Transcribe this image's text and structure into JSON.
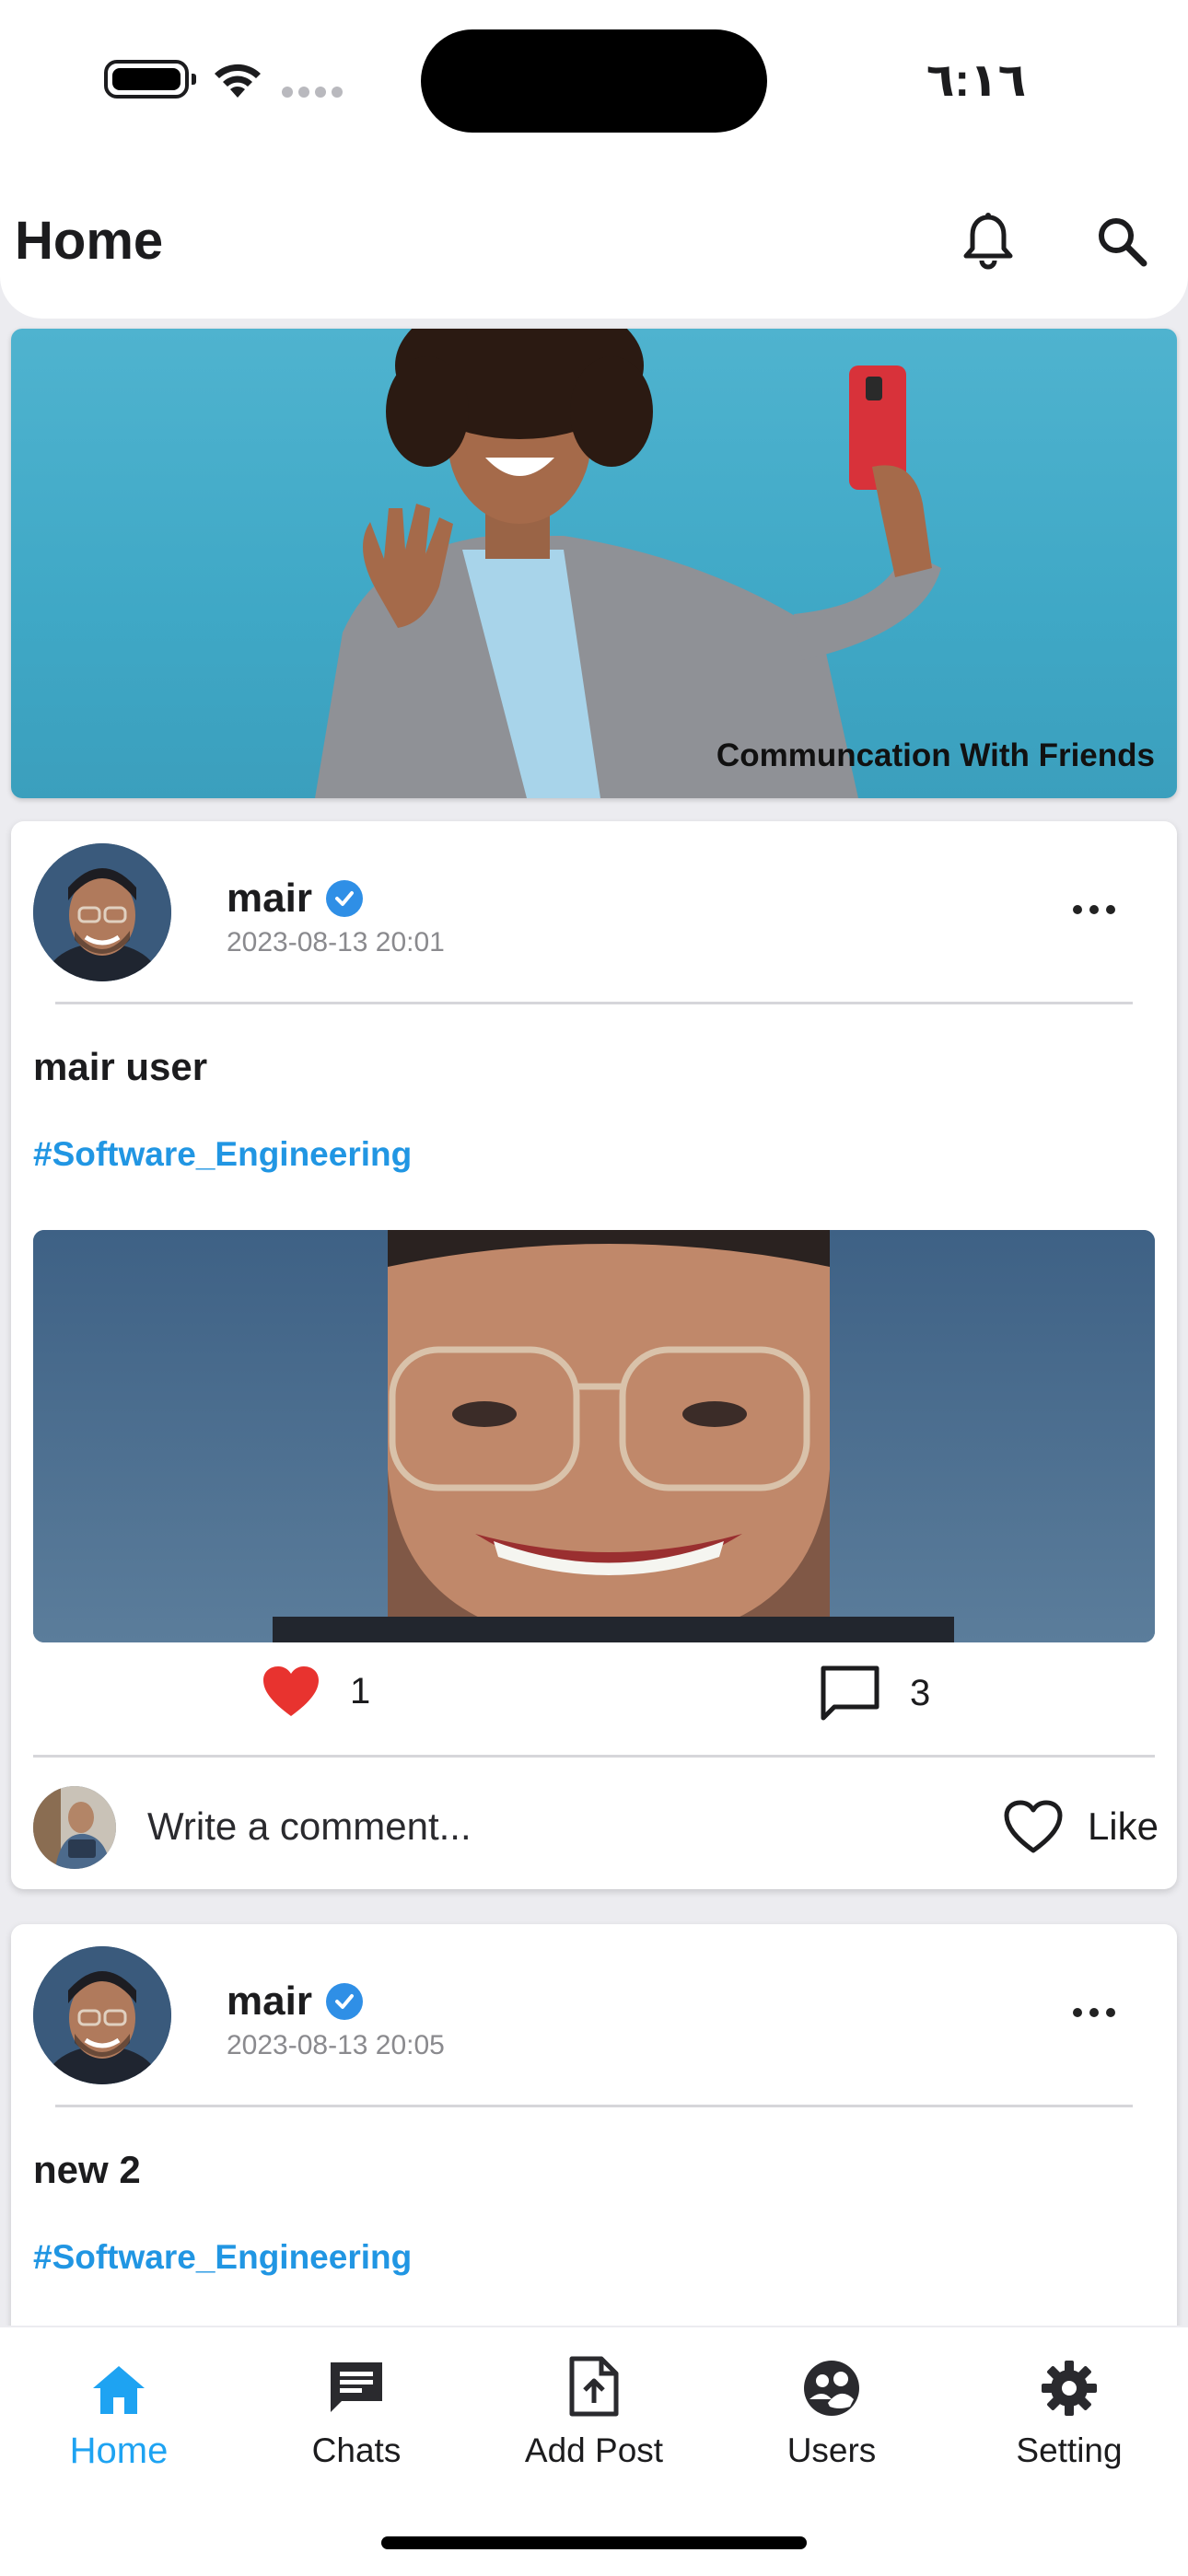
{
  "status_bar": {
    "time": "٦:١٦"
  },
  "app_bar": {
    "title": "Home",
    "notifications_icon": "bell-icon",
    "search_icon": "search-icon"
  },
  "banner": {
    "caption": "Communcation With Friends"
  },
  "posts": [
    {
      "author": "mair",
      "verified": true,
      "time": "2023-08-13 20:01",
      "text": "mair user",
      "hashtag": "#Software_Engineering",
      "likes": "1",
      "comments": "3",
      "comment_placeholder": "Write a comment...",
      "like_label": "Like"
    },
    {
      "author": "mair",
      "verified": true,
      "time": "2023-08-13 20:05",
      "text": "new 2",
      "hashtag": "#Software_Engineering"
    }
  ],
  "bottom_nav": {
    "items": [
      {
        "label": "Home",
        "icon": "home-icon",
        "active": true
      },
      {
        "label": "Chats",
        "icon": "chat-icon",
        "active": false
      },
      {
        "label": "Add Post",
        "icon": "add-post-icon",
        "active": false
      },
      {
        "label": "Users",
        "icon": "users-icon",
        "active": false
      },
      {
        "label": "Setting",
        "icon": "gear-icon",
        "active": false
      }
    ]
  },
  "colors": {
    "accent": "#1ea3f2",
    "hashtag": "#2196e3",
    "verified": "#2f8fe6",
    "like_heart": "#e8332f"
  }
}
